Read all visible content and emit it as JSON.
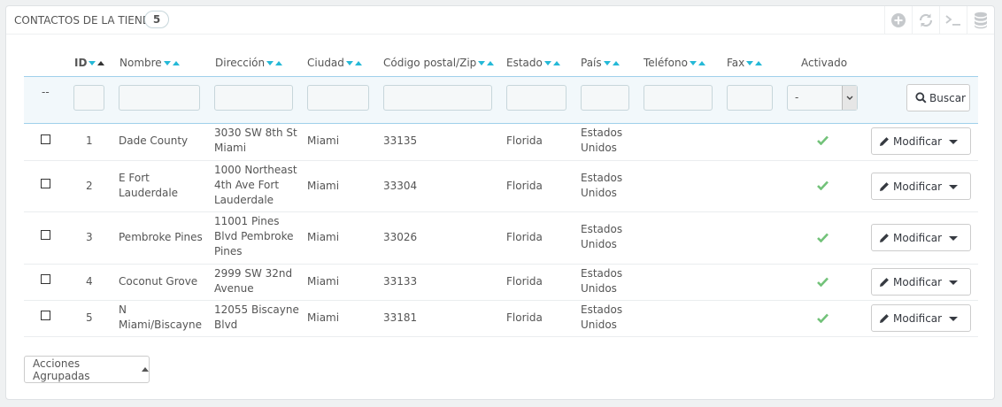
{
  "panel": {
    "title": "CONTACTOS DE LA TIENDA",
    "count": "5",
    "toolbar_icons": [
      "add-circle-icon",
      "refresh-icon",
      "terminal-icon",
      "database-icon"
    ]
  },
  "columns": {
    "id": "ID",
    "nombre": "Nombre",
    "direccion": "Dirección",
    "ciudad": "Ciudad",
    "postal": "Código postal/Zip",
    "estado": "Estado",
    "pais": "País",
    "telefono": "Teléfono",
    "fax": "Fax",
    "activado": "Activado"
  },
  "filters": {
    "dash": "--",
    "activado_value": "-",
    "search_label": "Buscar"
  },
  "rows": [
    {
      "id": "1",
      "nombre": [
        "Dade County"
      ],
      "direccion": [
        "3030 SW 8th St",
        "Miami"
      ],
      "ciudad": "Miami",
      "postal": "33135",
      "estado": "Florida",
      "pais": [
        "Estados",
        "Unidos"
      ],
      "telefono": "",
      "fax": "",
      "activado": true,
      "edit_label": "Modificar"
    },
    {
      "id": "2",
      "nombre": [
        "E Fort",
        "Lauderdale"
      ],
      "direccion": [
        "1000 Northeast",
        "4th Ave Fort",
        "Lauderdale"
      ],
      "ciudad": "Miami",
      "postal": "33304",
      "estado": "Florida",
      "pais": [
        "Estados",
        "Unidos"
      ],
      "telefono": "",
      "fax": "",
      "activado": true,
      "edit_label": "Modificar"
    },
    {
      "id": "3",
      "nombre": [
        "Pembroke Pines"
      ],
      "direccion": [
        "11001 Pines",
        "Blvd Pembroke",
        "Pines"
      ],
      "ciudad": "Miami",
      "postal": "33026",
      "estado": "Florida",
      "pais": [
        "Estados",
        "Unidos"
      ],
      "telefono": "",
      "fax": "",
      "activado": true,
      "edit_label": "Modificar"
    },
    {
      "id": "4",
      "nombre": [
        "Coconut Grove"
      ],
      "direccion": [
        "2999 SW 32nd",
        "Avenue"
      ],
      "ciudad": "Miami",
      "postal": "33133",
      "estado": "Florida",
      "pais": [
        "Estados",
        "Unidos"
      ],
      "telefono": "",
      "fax": "",
      "activado": true,
      "edit_label": "Modificar"
    },
    {
      "id": "5",
      "nombre": [
        "N",
        "Miami/Biscayne"
      ],
      "direccion": [
        "12055 Biscayne",
        "Blvd"
      ],
      "ciudad": "Miami",
      "postal": "33181",
      "estado": "Florida",
      "pais": [
        "Estados",
        "Unidos"
      ],
      "telefono": "",
      "fax": "",
      "activado": true,
      "edit_label": "Modificar"
    }
  ],
  "bulk_actions_label": "Acciones Agrupadas",
  "colors": {
    "accent": "#25b9d7",
    "active_check": "#72c279",
    "filter_bg": "#f2f8fb"
  }
}
